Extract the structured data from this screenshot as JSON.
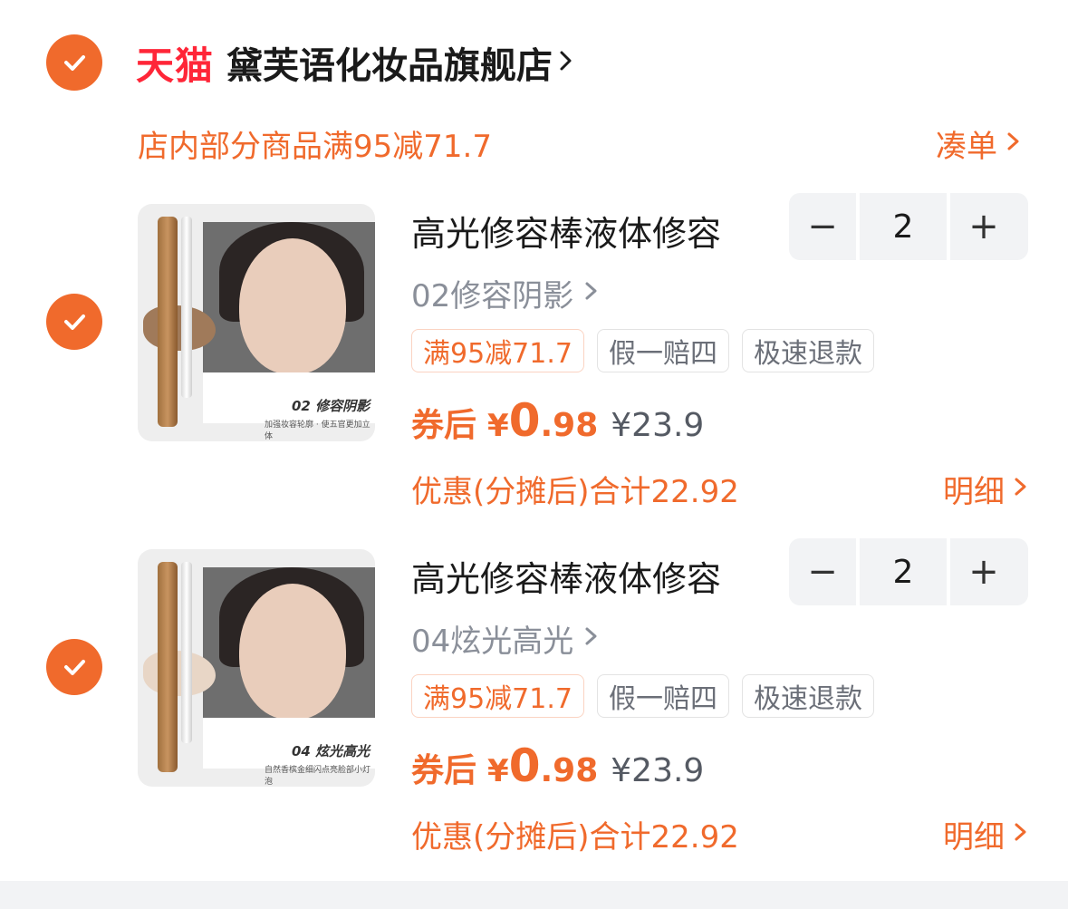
{
  "store": {
    "platform_label": "天猫",
    "name": "黛芙语化妆品旗舰店",
    "promo_text": "店内部分商品满95减71.7",
    "coudan_label": "凑单"
  },
  "items": [
    {
      "title": "高光修容棒液体修容",
      "variant": "02修容阴影",
      "quantity": "2",
      "minus_label": "−",
      "plus_label": "+",
      "tags": [
        "满95减71.7",
        "假一赔四",
        "极速退款"
      ],
      "price_label": "券后",
      "currency": "¥",
      "price_int": "0",
      "price_dec": ".98",
      "orig_price": "¥23.9",
      "discount_text": "优惠(分摊后)合计22.92",
      "detail_label": "明细",
      "image_caption": "02 修容阴影",
      "image_subcaption": "加强妆容轮廓 · 使五官更加立体",
      "swatch_color": "#a07a5a"
    },
    {
      "title": "高光修容棒液体修容",
      "variant": "04炫光高光",
      "quantity": "2",
      "minus_label": "−",
      "plus_label": "+",
      "tags": [
        "满95减71.7",
        "假一赔四",
        "极速退款"
      ],
      "price_label": "券后",
      "currency": "¥",
      "price_int": "0",
      "price_dec": ".98",
      "orig_price": "¥23.9",
      "discount_text": "优惠(分摊后)合计22.92",
      "detail_label": "明细",
      "image_caption": "04 炫光高光",
      "image_subcaption": "自然香槟金细闪点亮脸部小灯泡",
      "swatch_color": "#e8d6c6"
    }
  ],
  "colors": {
    "accent": "#f06a2c",
    "tmall_red": "#ff2638",
    "gray_text": "#8a8f99",
    "stepper_bg": "#f2f3f5"
  }
}
